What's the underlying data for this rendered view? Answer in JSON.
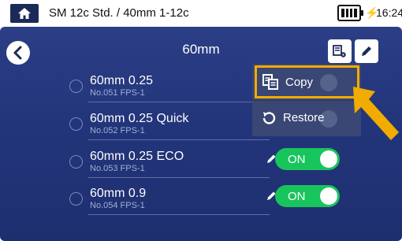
{
  "status_bar": {
    "title": "SM 12c Std. / 40mm 1-12c",
    "time": "16:24",
    "charging_symbol": "⚡",
    "icons": [
      "home-icon",
      "battery-icon",
      "charging-icon"
    ]
  },
  "header": {
    "title": "60mm",
    "icons": [
      "back-icon",
      "settings-icon",
      "edit-icon"
    ]
  },
  "list": {
    "items": [
      {
        "name": "60mm 0.25",
        "sub": "No.051 FPS-1",
        "toggle": ""
      },
      {
        "name": "60mm 0.25 Quick",
        "sub": "No.052 FPS-1",
        "toggle": ""
      },
      {
        "name": "60mm 0.25 ECO",
        "sub": "No.053 FPS-1",
        "toggle": "ON"
      },
      {
        "name": "60mm 0.9",
        "sub": "No.054 FPS-1",
        "toggle": "ON"
      }
    ]
  },
  "menu": {
    "copy_label": "Copy",
    "restore_label": "Restore",
    "highlight_color": "#f2ab00"
  },
  "colors": {
    "accent": "#f2ab00",
    "toggle_on": "#18c55c",
    "background": "#23357a"
  }
}
